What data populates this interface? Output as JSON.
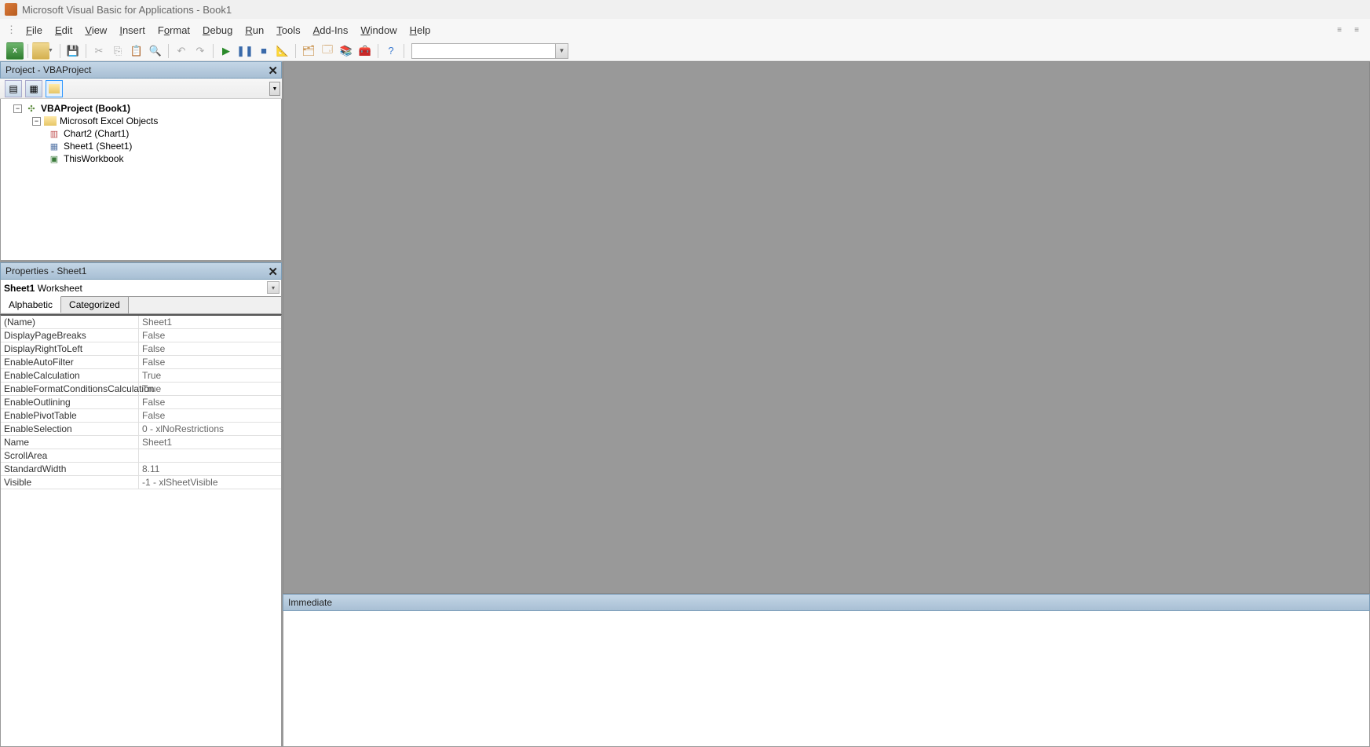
{
  "titlebar": {
    "text": "Microsoft Visual Basic for Applications - Book1"
  },
  "menu": {
    "items": [
      "File",
      "Edit",
      "View",
      "Insert",
      "Format",
      "Debug",
      "Run",
      "Tools",
      "Add-Ins",
      "Window",
      "Help"
    ]
  },
  "project": {
    "title": "Project - VBAProject",
    "root": "VBAProject (Book1)",
    "folder": "Microsoft Excel Objects",
    "items": [
      "Chart2 (Chart1)",
      "Sheet1 (Sheet1)",
      "ThisWorkbook"
    ]
  },
  "properties": {
    "title": "Properties - Sheet1",
    "object_name": "Sheet1",
    "object_type": "Worksheet",
    "tabs": [
      "Alphabetic",
      "Categorized"
    ],
    "rows": [
      {
        "name": "(Name)",
        "value": "Sheet1"
      },
      {
        "name": "DisplayPageBreaks",
        "value": "False"
      },
      {
        "name": "DisplayRightToLeft",
        "value": "False"
      },
      {
        "name": "EnableAutoFilter",
        "value": "False"
      },
      {
        "name": "EnableCalculation",
        "value": "True"
      },
      {
        "name": "EnableFormatConditionsCalculation",
        "value": "True"
      },
      {
        "name": "EnableOutlining",
        "value": "False"
      },
      {
        "name": "EnablePivotTable",
        "value": "False"
      },
      {
        "name": "EnableSelection",
        "value": "0 - xlNoRestrictions"
      },
      {
        "name": "Name",
        "value": "Sheet1"
      },
      {
        "name": "ScrollArea",
        "value": ""
      },
      {
        "name": "StandardWidth",
        "value": "8.11"
      },
      {
        "name": "Visible",
        "value": "-1 - xlSheetVisible"
      }
    ]
  },
  "immediate": {
    "title": "Immediate"
  }
}
